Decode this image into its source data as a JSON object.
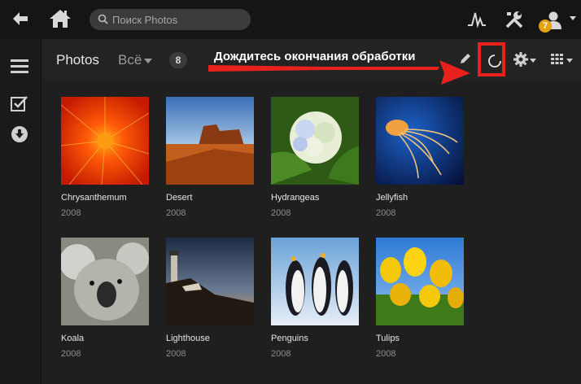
{
  "topbar": {
    "search_placeholder": "Поиск Photos",
    "notification_count": "7"
  },
  "library": {
    "title": "Photos",
    "filter": "Всё",
    "count": "8"
  },
  "annotation": {
    "text": "Дождитесь окончания обработки",
    "color": "#e8211c"
  },
  "photos": [
    {
      "name": "Chrysanthemum",
      "year": "2008"
    },
    {
      "name": "Desert",
      "year": "2008"
    },
    {
      "name": "Hydrangeas",
      "year": "2008"
    },
    {
      "name": "Jellyfish",
      "year": "2008"
    },
    {
      "name": "Koala",
      "year": "2008"
    },
    {
      "name": "Lighthouse",
      "year": "2008"
    },
    {
      "name": "Penguins",
      "year": "2008"
    },
    {
      "name": "Tulips",
      "year": "2008"
    }
  ],
  "icons": {
    "back": "back-arrow-icon",
    "home": "home-icon",
    "search": "search-icon",
    "activity": "activity-icon",
    "settings": "tools-icon",
    "user": "user-icon",
    "menu": "hamburger-icon",
    "select": "checkbox-icon",
    "download": "download-icon",
    "edit": "pencil-icon",
    "processing": "spinner-icon",
    "options": "gear-icon",
    "view": "grid-icon"
  }
}
